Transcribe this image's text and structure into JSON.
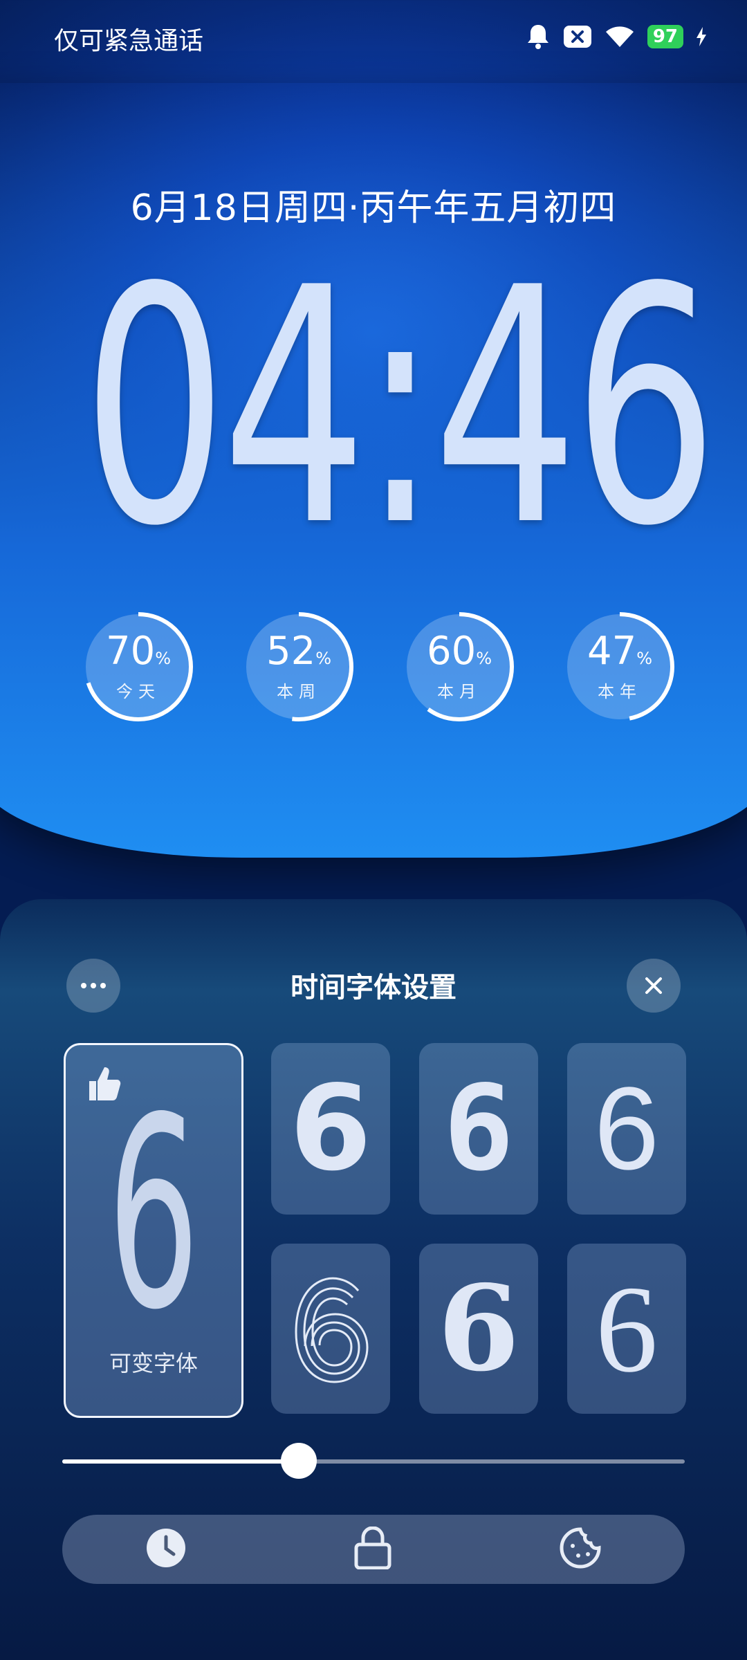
{
  "status_bar": {
    "carrier": "仅可紧急通话",
    "battery": "97"
  },
  "lock_screen": {
    "date": "6月18日周四·丙午年五月初四",
    "time": "04:46",
    "progress": [
      {
        "value": "70",
        "unit": "%",
        "label": "今天",
        "fraction": 0.7
      },
      {
        "value": "52",
        "unit": "%",
        "label": "本周",
        "fraction": 0.52
      },
      {
        "value": "60",
        "unit": "%",
        "label": "本月",
        "fraction": 0.6
      },
      {
        "value": "47",
        "unit": "%",
        "label": "本年",
        "fraction": 0.47
      }
    ]
  },
  "font_panel": {
    "title": "时间字体设置",
    "selected_label": "可变字体",
    "glyph": "6",
    "slider_fraction": 0.38
  },
  "bottom_tabs": [
    "clock-icon",
    "lock-icon",
    "palette-icon"
  ]
}
